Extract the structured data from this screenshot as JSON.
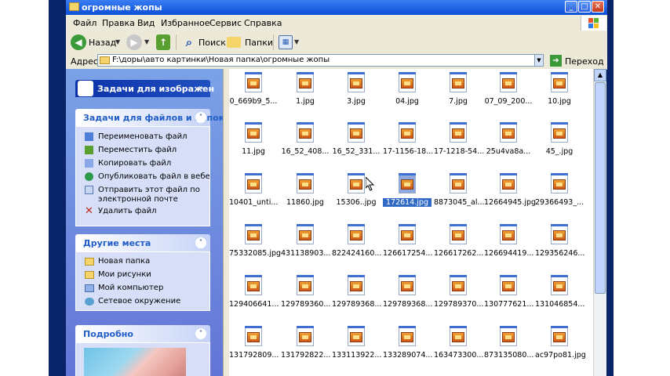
{
  "title": "огромные жопы",
  "menu": [
    "Файл",
    "Правка",
    "Вид",
    "Избранное",
    "Сервис",
    "Справка"
  ],
  "toolbar": {
    "back": "Назад",
    "search": "Поиск",
    "folders": "Папки"
  },
  "address": {
    "label": "Адрес:",
    "path": "F:\\доры\\авто картинки\\Новая папка\\огромные жопы",
    "go": "Переход"
  },
  "panels": {
    "image_tasks": {
      "title": "Задачи для изображен"
    },
    "file_tasks": {
      "title": "Задачи для файлов и папок",
      "items": [
        "Переименовать файл",
        "Переместить файл",
        "Копировать файл",
        "Опубликовать файл в вебе",
        "Отправить этот файл по электронной почте",
        "Удалить файл"
      ]
    },
    "other_places": {
      "title": "Другие места",
      "items": [
        "Новая папка",
        "Мои рисунки",
        "Мой компьютер",
        "Сетевое окружение"
      ]
    },
    "details": {
      "title": "Подробно"
    }
  },
  "files": [
    "0_669b9_5...",
    "1.jpg",
    "3.jpg",
    "04.jpg",
    "7.jpg",
    "07_09_200...",
    "10.jpg",
    "11.jpg",
    "16_52_408...",
    "16_52_331...",
    "17-1156-18...",
    "17-1218-54...",
    "25u4va8a...",
    "45_.jpg",
    "10401_unti...",
    "11860.jpg",
    "15306..jpg",
    "172614.jpg",
    "8873045_al...",
    "12664945.jpg",
    "29366493_...",
    "75332085.jpg",
    "431138903...",
    "822424160...",
    "126617254...",
    "126617262...",
    "126694419...",
    "129356246...",
    "129406641...",
    "129789360...",
    "129789368...",
    "129789368...",
    "129789370...",
    "130777621...",
    "131046854...",
    "131792809...",
    "131792822...",
    "133113922...",
    "133289074...",
    "163473300...",
    "873135080...",
    "ac97po81.jpg"
  ],
  "selected_file": "172614.jpg",
  "colors": {
    "titlebar": "#0a4fd8",
    "taskpane": "#6375d6",
    "selection": "#316ac5"
  }
}
